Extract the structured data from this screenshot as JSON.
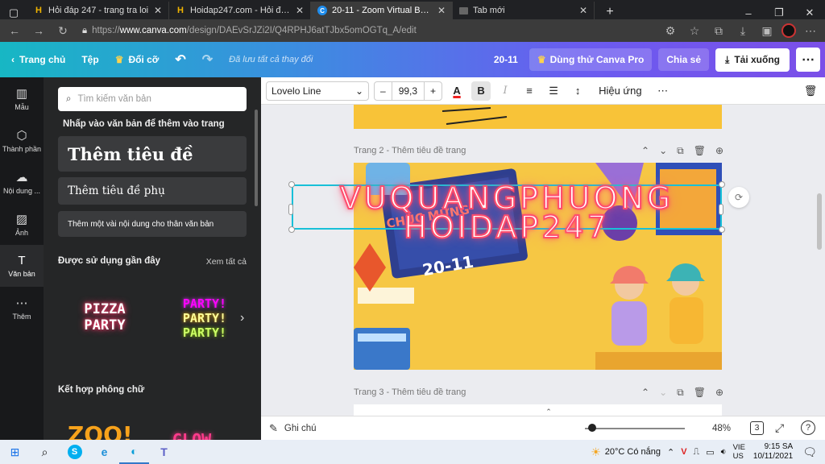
{
  "browser": {
    "tabs": [
      {
        "icon": "h-favicon",
        "title": "Hỏi đáp 247 - trang tra loi",
        "active": false
      },
      {
        "icon": "h-favicon",
        "title": "Hoidap247.com - Hỏi đáp online",
        "active": false
      },
      {
        "icon": "canva-favicon",
        "title": "20-11 - Zoom Virtual Backgrou",
        "active": true
      },
      {
        "icon": "new-tab-favicon",
        "title": "Tab mới",
        "active": false
      }
    ],
    "new_tab": "+",
    "url_prefix": "https://",
    "url_host": "www.canva.com",
    "url_path": "/design/DAEvSrJZi2I/Q4RPHJ6atTJbx5omOGTq_A/edit"
  },
  "canva_header": {
    "home": "Trang chủ",
    "file": "Tệp",
    "resize": "Đổi cỡ",
    "saved": "Đã lưu tất cả thay đổi",
    "design_title": "20-11",
    "try_pro": "Dùng thử Canva Pro",
    "share": "Chia sẻ",
    "download": "Tải xuống"
  },
  "rail": [
    {
      "icon": "template-icon",
      "label": "Mẫu"
    },
    {
      "icon": "elements-icon",
      "label": "Thành phần"
    },
    {
      "icon": "upload-icon",
      "label": "Nội dung ..."
    },
    {
      "icon": "photo-icon",
      "label": "Ảnh"
    },
    {
      "icon": "text-icon",
      "label": "Văn bản",
      "active": true
    },
    {
      "icon": "more-icon",
      "label": "Thêm"
    }
  ],
  "panel": {
    "search_placeholder": "Tìm kiếm văn bản",
    "hint": "Nhấp vào văn bản để thêm vào trang",
    "add_heading": "Thêm tiêu đề",
    "add_subheading": "Thêm tiêu đề phụ",
    "add_body": "Thêm một vài nội dung cho thân văn bản",
    "recent_title": "Được sử dụng gần đây",
    "see_all": "Xem tất cả",
    "recent1_line1": "PIZZA",
    "recent1_line2": "PARTY",
    "recent2_line1": "PARTY!",
    "recent2_line2": "PARTY!",
    "recent2_line3": "PARTY!",
    "combo_title": "Kết hợp phông chữ",
    "combo1": "ZOO!",
    "combo2": "GLOW"
  },
  "toolbar": {
    "font": "Lovelo Line",
    "size": "99,3",
    "minus": "–",
    "plus": "+",
    "effects": "Hiệu ứng"
  },
  "editor": {
    "page2_label": "Trang 2 - Thêm tiêu đề trang",
    "page3_label": "Trang 3 - Thêm tiêu đề trang",
    "text_line1": "VUQUANGPHUONG",
    "text_line2": "HOIDAP247",
    "card_text1": "CHÚC MỪNG",
    "card_date": "20-11"
  },
  "bottom": {
    "notes": "Ghi chú",
    "zoom": "48%",
    "zoom_level": 0.48,
    "pages": "3"
  },
  "taskbar": {
    "weather": "20°C  Có nắng",
    "lang_top": "VIE",
    "lang_bottom": "US",
    "time": "9:15 SA",
    "date": "10/11/2021"
  },
  "colors": {
    "neon_red": "#ff4d6d",
    "selection": "#18c0d8",
    "page_bg": "#f6c744"
  }
}
